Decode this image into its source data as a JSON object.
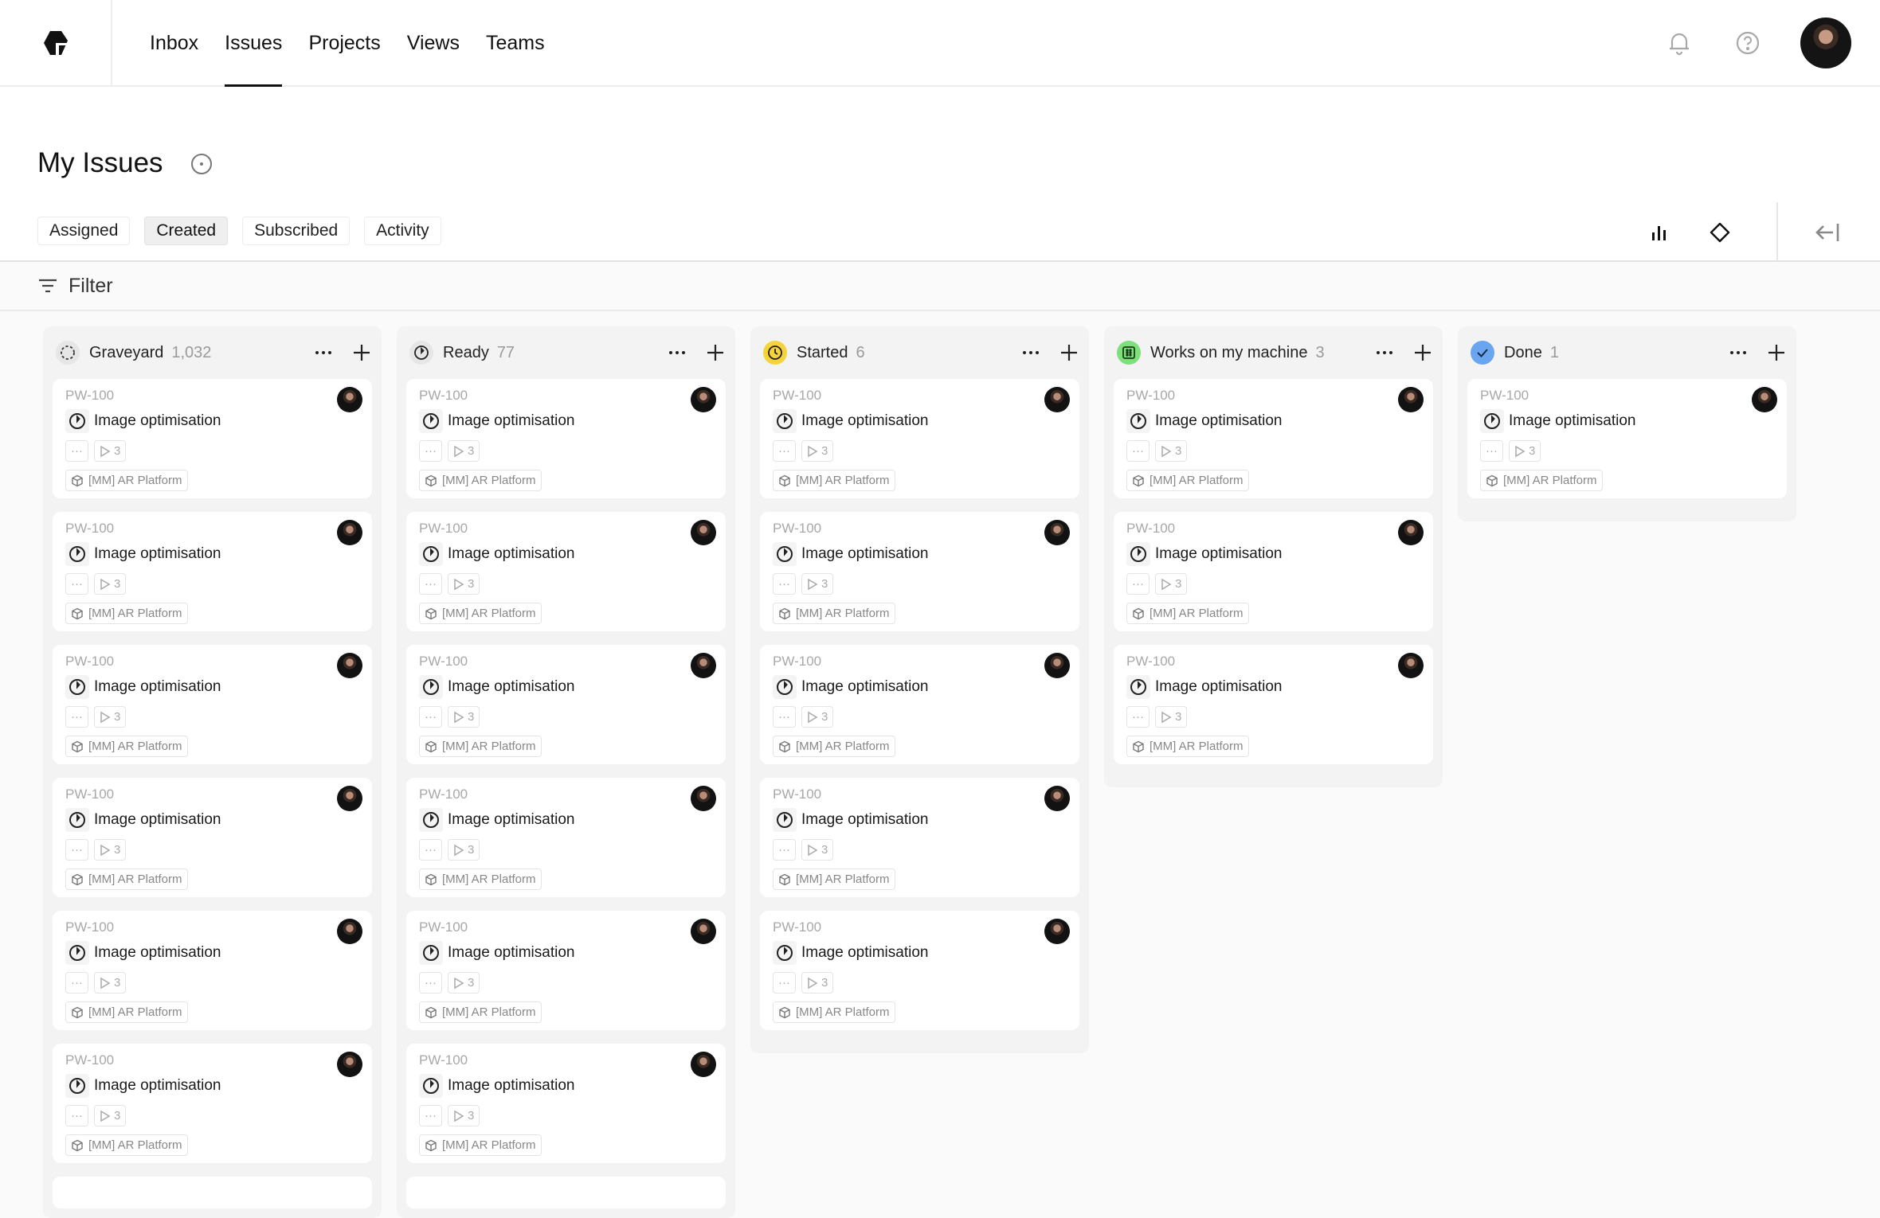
{
  "nav": {
    "links": [
      {
        "label": "Inbox",
        "active": false
      },
      {
        "label": "Issues",
        "active": true
      },
      {
        "label": "Projects",
        "active": false
      },
      {
        "label": "Views",
        "active": false
      },
      {
        "label": "Teams",
        "active": false
      }
    ],
    "icons": [
      "bell-icon",
      "help-icon"
    ]
  },
  "header": {
    "title": "My Issues",
    "tabs": [
      {
        "label": "Assigned",
        "active": false
      },
      {
        "label": "Created",
        "active": true
      },
      {
        "label": "Subscribed",
        "active": false
      },
      {
        "label": "Activity",
        "active": false
      }
    ]
  },
  "filter": {
    "label": "Filter"
  },
  "columns": [
    {
      "title": "Graveyard",
      "count": "1,032",
      "status": "graveyard",
      "color": "#e6e6e6",
      "visible_cards": 6
    },
    {
      "title": "Ready",
      "count": "77",
      "status": "ready",
      "color": "#e6e6e6",
      "visible_cards": 6
    },
    {
      "title": "Started",
      "count": "6",
      "status": "started",
      "color": "#f5d33b",
      "visible_cards": 5
    },
    {
      "title": "Works on my machine",
      "count": "3",
      "status": "works",
      "color": "#7ee07a",
      "visible_cards": 3
    },
    {
      "title": "Done",
      "count": "1",
      "status": "done",
      "color": "#6aa5f0",
      "visible_cards": 1
    }
  ],
  "card": {
    "id": "PW-100",
    "title": "Image optimisation",
    "more": "···",
    "sub_count": "3",
    "project": "[MM] AR Platform"
  }
}
